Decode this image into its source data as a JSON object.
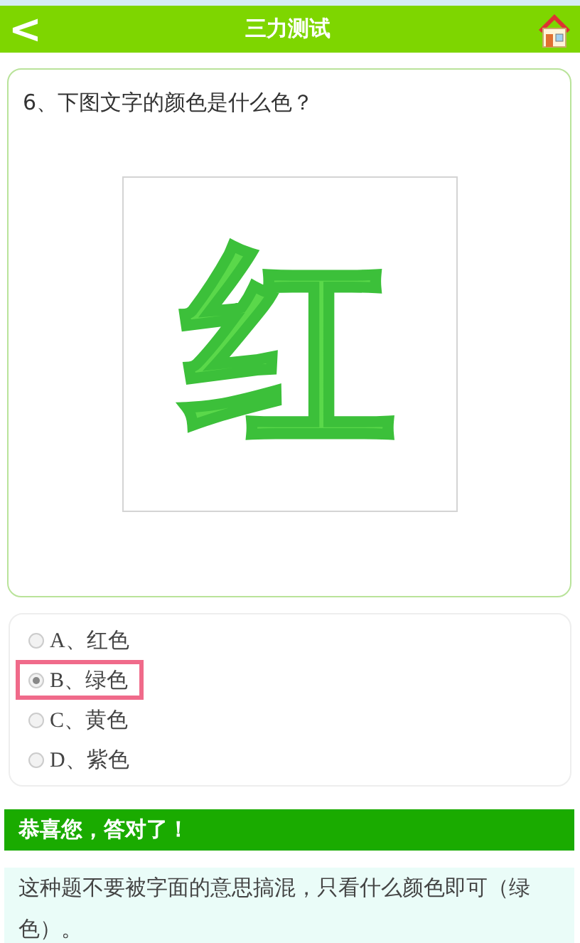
{
  "header": {
    "back": "<",
    "title": "三力测试"
  },
  "question": {
    "text": "6、下图文字的颜色是什么色？",
    "image_character": "红"
  },
  "options": [
    {
      "label": "A、红色",
      "selected": false
    },
    {
      "label": "B、绿色",
      "selected": true
    },
    {
      "label": "C、黄色",
      "selected": false
    },
    {
      "label": "D、紫色",
      "selected": false
    }
  ],
  "result": {
    "title": "恭喜您，答对了！",
    "explanation": "这种题不要被字面的意思搞混，只看什么颜色即可（绿色）。"
  }
}
